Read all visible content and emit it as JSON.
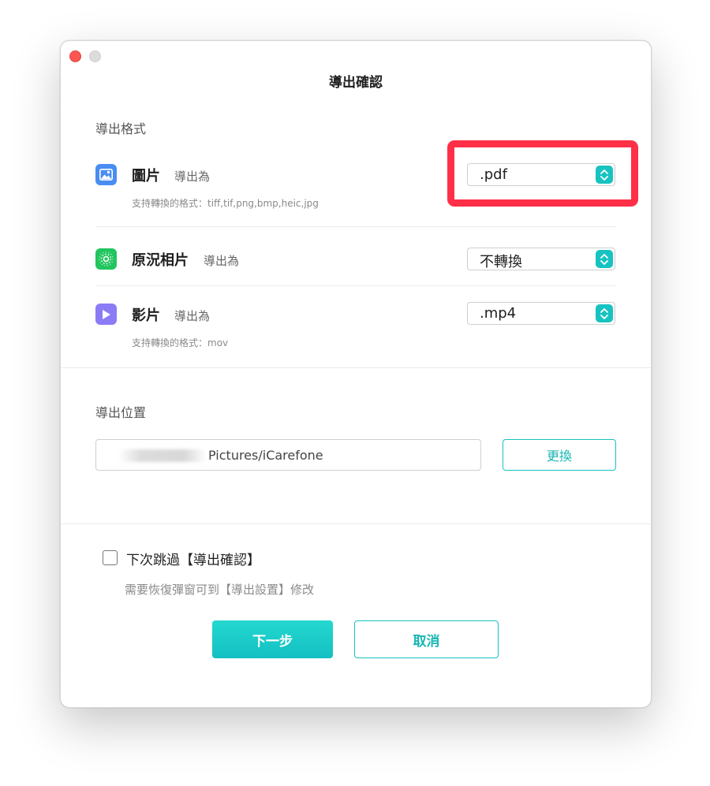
{
  "window": {
    "title": "導出確認"
  },
  "export_format": {
    "label": "導出格式",
    "items": [
      {
        "name": "圖片",
        "export_label": "導出為",
        "value": ".pdf",
        "hint": "支持轉換的格式：tiff,tif,png,bmp,heic,jpg",
        "icon": "image-icon",
        "highlighted": true
      },
      {
        "name": "原況相片",
        "export_label": "導出為",
        "value": "不轉換",
        "hint": "",
        "icon": "live-photo-icon",
        "highlighted": false
      },
      {
        "name": "影片",
        "export_label": "導出為",
        "value": ".mp4",
        "hint": "支持轉換的格式：mov",
        "icon": "video-play-icon",
        "highlighted": false
      }
    ]
  },
  "export_location": {
    "label": "導出位置",
    "path": "Pictures/iCarefone",
    "change_label": "更換"
  },
  "skip": {
    "label": "下次跳過【導出確認】",
    "hint": "需要恢復彈窗可到【導出設置】修改",
    "checked": false
  },
  "actions": {
    "next_label": "下一步",
    "cancel_label": "取消"
  },
  "colors": {
    "accent": "#17c3c1",
    "highlight": "#ff2f48",
    "close": "#fc5753"
  }
}
